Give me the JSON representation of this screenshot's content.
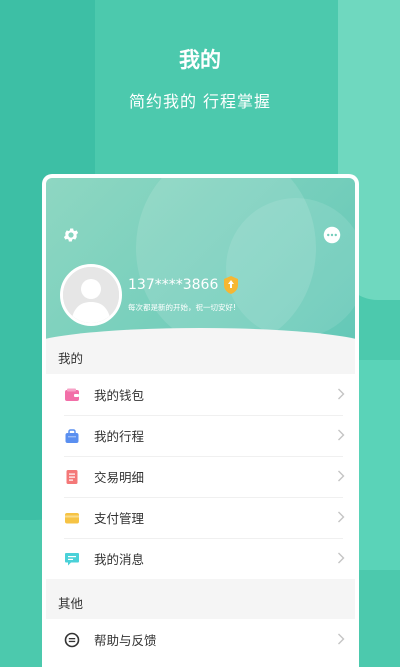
{
  "hero": {
    "title": "我的",
    "subtitle": "简约我的  行程掌握"
  },
  "profile": {
    "phone": "137****3866",
    "motto": "每次都是新的开始，祝一切安好!"
  },
  "sections": {
    "mine_label": "我的",
    "other_label": "其他"
  },
  "menu": {
    "wallet": "我的钱包",
    "trips": "我的行程",
    "transactions": "交易明细",
    "payment": "支付管理",
    "messages": "我的消息",
    "help": "帮助与反馈"
  },
  "icons": {
    "settings": "gear-icon",
    "more": "more-icon",
    "verified": "shield-badge-icon",
    "wallet": "wallet-icon",
    "trips": "bag-icon",
    "transactions": "receipt-icon",
    "payment": "card-icon",
    "messages": "chat-icon",
    "help": "help-icon",
    "chevron": "chevron-right-icon"
  },
  "colors": {
    "background": "#4cc9ad",
    "header": "#74cdbb",
    "wallet": "#f26fa8",
    "trips": "#5a8ff0",
    "transactions": "#f47878",
    "payment": "#f6c344",
    "messages": "#4ad1d8"
  }
}
